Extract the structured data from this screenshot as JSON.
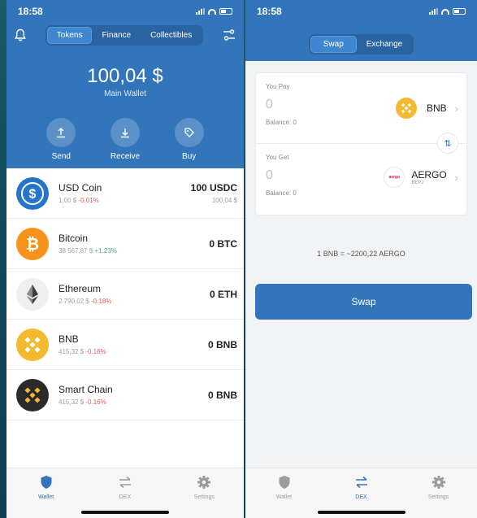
{
  "left": {
    "status": {
      "time": "18:58"
    },
    "tabs": [
      "Tokens",
      "Finance",
      "Collectibles"
    ],
    "balance": "100,04 $",
    "wallet_name": "Main Wallet",
    "actions": [
      "Send",
      "Receive",
      "Buy"
    ],
    "tokens": [
      {
        "name": "USD Coin",
        "price": "1,00 $",
        "change": "-0.01%",
        "change_type": "neg",
        "amount": "100 USDC",
        "value": "100,04 $",
        "icon": "usdc-coin-icon",
        "color": "#2775ca"
      },
      {
        "name": "Bitcoin",
        "price": "38 567,87 $",
        "change": "+1.23%",
        "change_type": "pos",
        "amount": "0 BTC",
        "value": "",
        "icon": "bitcoin-coin-icon",
        "color": "#f7931a"
      },
      {
        "name": "Ethereum",
        "price": "2 790,02 $",
        "change": "-0.18%",
        "change_type": "neg",
        "amount": "0 ETH",
        "value": "",
        "icon": "ethereum-coin-icon",
        "color": "#f0f0f0"
      },
      {
        "name": "BNB",
        "price": "415,32 $",
        "change": "-0.16%",
        "change_type": "neg",
        "amount": "0 BNB",
        "value": "",
        "icon": "bnb-coin-icon",
        "color": "#f3ba2f"
      },
      {
        "name": "Smart Chain",
        "price": "415,32 $",
        "change": "-0.16%",
        "change_type": "neg",
        "amount": "0 BNB",
        "value": "",
        "icon": "smart-chain-coin-icon",
        "color": "#2b2b2b"
      }
    ],
    "tabbar": [
      "Wallet",
      "DEX",
      "Settings"
    ]
  },
  "right": {
    "status": {
      "time": "18:58"
    },
    "tabs": [
      "Swap",
      "Exchange"
    ],
    "pay": {
      "label": "You Pay",
      "value": "0",
      "balance": "Balance: 0",
      "coin": "BNB"
    },
    "get": {
      "label": "You Get",
      "value": "0",
      "balance": "Balance: 0",
      "coin": "AERGO",
      "network": "BEP2",
      "logo_text": "aergo"
    },
    "rate": "1 BNB = ~2200,22 AERGO",
    "swap_label": "Swap",
    "tabbar": [
      "Wallet",
      "DEX",
      "Settings"
    ]
  },
  "colors": {
    "primary": "#3375bb",
    "negative": "#e06060",
    "positive": "#3bb09a"
  }
}
